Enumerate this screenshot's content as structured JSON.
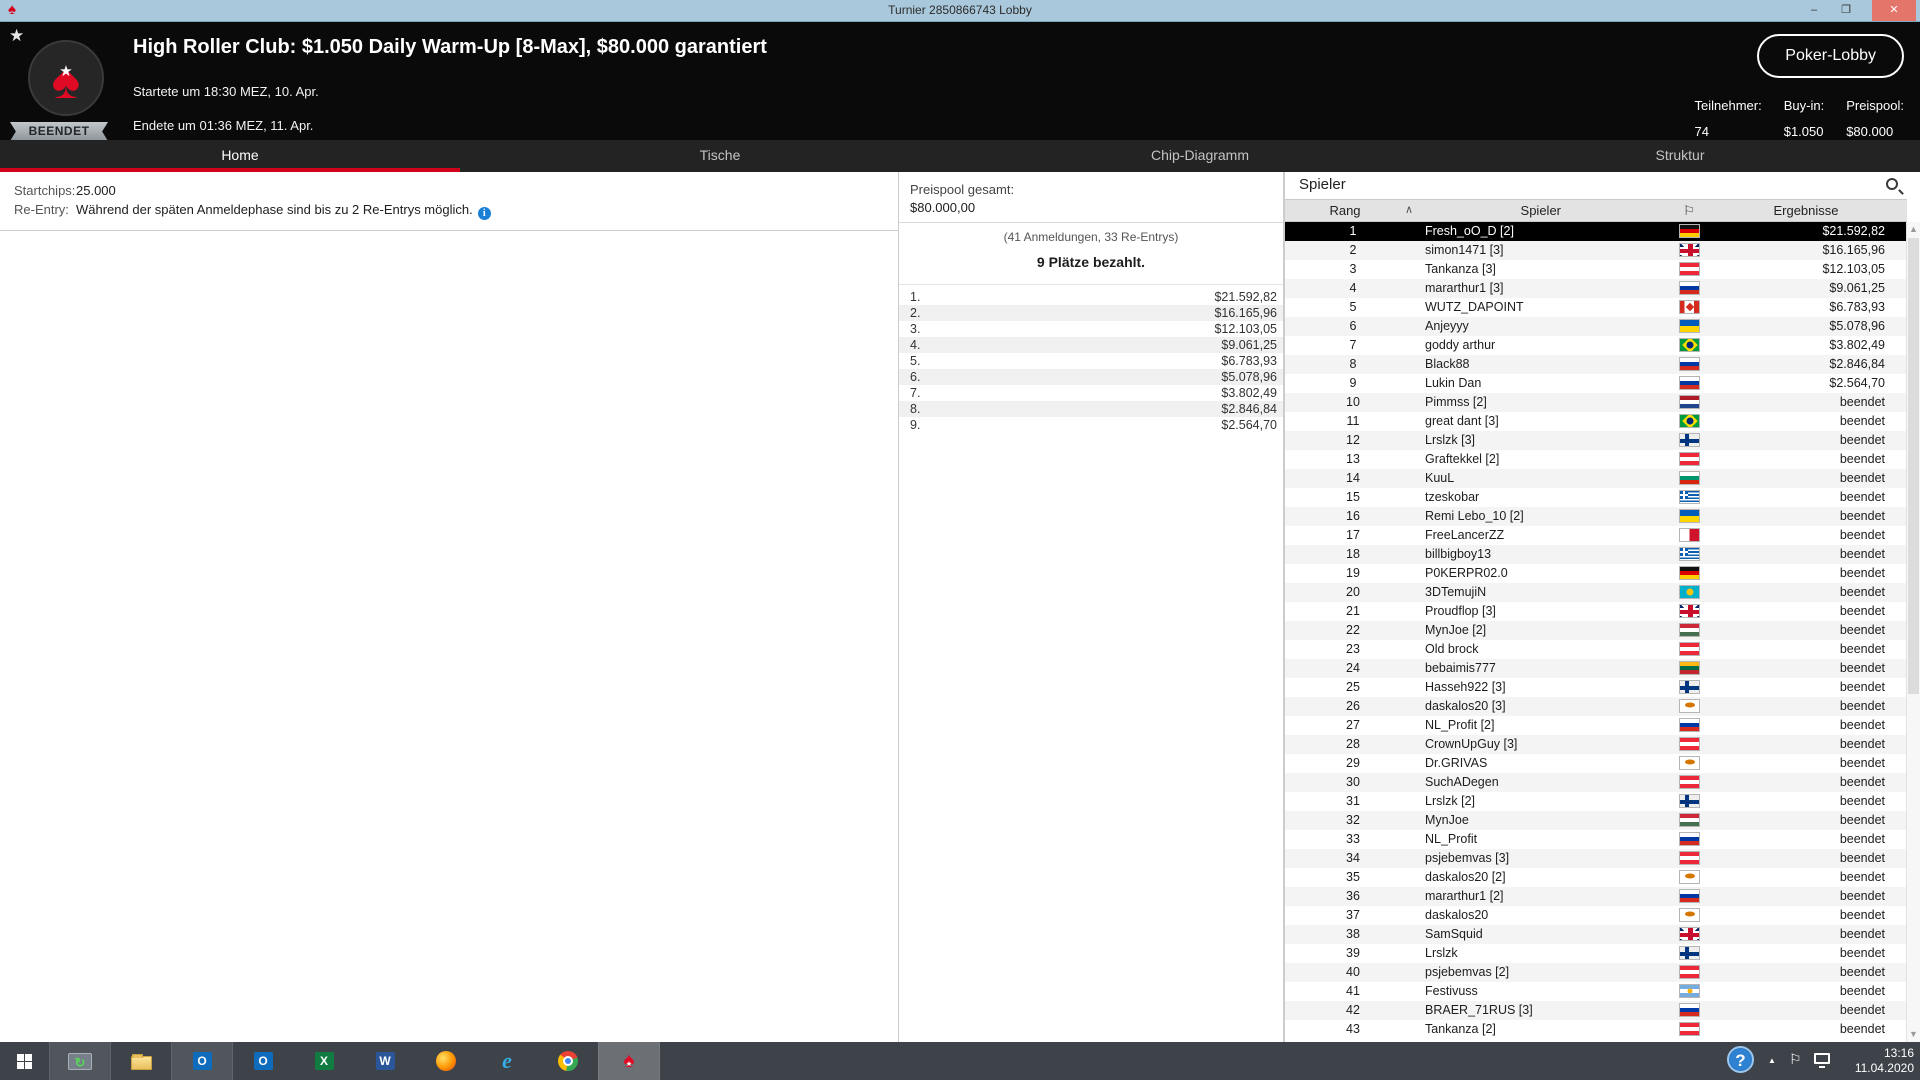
{
  "window": {
    "title": "Turnier 2850866743 Lobby",
    "controls": {
      "minimize": "–",
      "restore": "❐",
      "close": "✕"
    }
  },
  "header": {
    "status_badge": "BEENDET",
    "title": "High Roller Club: $1.050 Daily Warm-Up [8-Max], $80.000 garantiert",
    "started": "Startete um 18:30 MEZ, 10. Apr.",
    "ended": "Endete um 01:36 MEZ, 11. Apr.",
    "lobby_button": "Poker-Lobby",
    "stats": [
      {
        "label": "Teilnehmer:",
        "value": "74"
      },
      {
        "label": "Buy-in:",
        "value": "$1.050"
      },
      {
        "label": "Preispool:",
        "value": "$80.000"
      }
    ]
  },
  "tabs": [
    {
      "label": "Home",
      "active": true
    },
    {
      "label": "Tische",
      "active": false
    },
    {
      "label": "Chip-Diagramm",
      "active": false
    },
    {
      "label": "Struktur",
      "active": false
    }
  ],
  "info_panel": {
    "rows": [
      {
        "label": "Startchips:",
        "value": "25.000",
        "info_icon": false
      },
      {
        "label": "Re-Entry:",
        "value": "Während der späten Anmeldephase sind bis zu 2 Re-Entrys möglich.",
        "info_icon": true
      }
    ],
    "info_icon_glyph": "i"
  },
  "prize_panel": {
    "total_label": "Preispool gesamt:",
    "total_value": "$80.000,00",
    "registrations": "(41 Anmeldungen, 33 Re-Entrys)",
    "places_paid": "9 Plätze bezahlt.",
    "prizes": [
      {
        "place": "1.",
        "amount": "$21.592,82"
      },
      {
        "place": "2.",
        "amount": "$16.165,96"
      },
      {
        "place": "3.",
        "amount": "$12.103,05"
      },
      {
        "place": "4.",
        "amount": "$9.061,25"
      },
      {
        "place": "5.",
        "amount": "$6.783,93"
      },
      {
        "place": "6.",
        "amount": "$5.078,96"
      },
      {
        "place": "7.",
        "amount": "$3.802,49"
      },
      {
        "place": "8.",
        "amount": "$2.846,84"
      },
      {
        "place": "9.",
        "amount": "$2.564,70"
      }
    ]
  },
  "players_panel": {
    "title": "Spieler",
    "columns": {
      "rank": "Rang",
      "sort_icon": "∧",
      "player": "Spieler",
      "flag_icon": "⚐",
      "results": "Ergebnisse"
    },
    "players": [
      {
        "rank": "1",
        "name": "Fresh_oO_D [2]",
        "country": "de",
        "result": "$21.592,82",
        "selected": true
      },
      {
        "rank": "2",
        "name": "simon1471 [3]",
        "country": "gb",
        "result": "$16.165,96",
        "selected": false
      },
      {
        "rank": "3",
        "name": "Tankanza [3]",
        "country": "at",
        "result": "$12.103,05",
        "selected": false
      },
      {
        "rank": "4",
        "name": "mararthur1 [3]",
        "country": "ru",
        "result": "$9.061,25",
        "selected": false
      },
      {
        "rank": "5",
        "name": "WUTZ_DAPOINT",
        "country": "ca",
        "result": "$6.783,93",
        "selected": false
      },
      {
        "rank": "6",
        "name": "Anjeyyy",
        "country": "ua",
        "result": "$5.078,96",
        "selected": false
      },
      {
        "rank": "7",
        "name": "goddy arthur",
        "country": "br",
        "result": "$3.802,49",
        "selected": false
      },
      {
        "rank": "8",
        "name": "Black88",
        "country": "ru",
        "result": "$2.846,84",
        "selected": false
      },
      {
        "rank": "9",
        "name": "Lukin Dan",
        "country": "ru",
        "result": "$2.564,70",
        "selected": false
      },
      {
        "rank": "10",
        "name": "Pimmss [2]",
        "country": "nl",
        "result": "beendet",
        "selected": false
      },
      {
        "rank": "11",
        "name": "great dant [3]",
        "country": "br",
        "result": "beendet",
        "selected": false
      },
      {
        "rank": "12",
        "name": "Lrslzk [3]",
        "country": "fi",
        "result": "beendet",
        "selected": false
      },
      {
        "rank": "13",
        "name": "Graftekkel [2]",
        "country": "at",
        "result": "beendet",
        "selected": false
      },
      {
        "rank": "14",
        "name": "KuuL",
        "country": "bg",
        "result": "beendet",
        "selected": false
      },
      {
        "rank": "15",
        "name": "tzeskobar",
        "country": "gr",
        "result": "beendet",
        "selected": false
      },
      {
        "rank": "16",
        "name": "Remi Lebo_10 [2]",
        "country": "ua",
        "result": "beendet",
        "selected": false
      },
      {
        "rank": "17",
        "name": "FreeLancerZZ",
        "country": "mt",
        "result": "beendet",
        "selected": false
      },
      {
        "rank": "18",
        "name": "billbigboy13",
        "country": "gr",
        "result": "beendet",
        "selected": false
      },
      {
        "rank": "19",
        "name": "P0KERPR02.0",
        "country": "de",
        "result": "beendet",
        "selected": false
      },
      {
        "rank": "20",
        "name": "3DTemujiN",
        "country": "kz",
        "result": "beendet",
        "selected": false
      },
      {
        "rank": "21",
        "name": "Proudflop [3]",
        "country": "gb",
        "result": "beendet",
        "selected": false
      },
      {
        "rank": "22",
        "name": "MynJoe [2]",
        "country": "hu",
        "result": "beendet",
        "selected": false
      },
      {
        "rank": "23",
        "name": "Old brock",
        "country": "at",
        "result": "beendet",
        "selected": false
      },
      {
        "rank": "24",
        "name": "bebaimis777",
        "country": "lt",
        "result": "beendet",
        "selected": false
      },
      {
        "rank": "25",
        "name": "Hasseh922 [3]",
        "country": "fi",
        "result": "beendet",
        "selected": false
      },
      {
        "rank": "26",
        "name": "daskalos20 [3]",
        "country": "cy",
        "result": "beendet",
        "selected": false
      },
      {
        "rank": "27",
        "name": "NL_Profit [2]",
        "country": "ru",
        "result": "beendet",
        "selected": false
      },
      {
        "rank": "28",
        "name": "CrownUpGuy [3]",
        "country": "at",
        "result": "beendet",
        "selected": false
      },
      {
        "rank": "29",
        "name": "Dr.GRIVAS",
        "country": "cy",
        "result": "beendet",
        "selected": false
      },
      {
        "rank": "30",
        "name": "SuchADegen",
        "country": "at",
        "result": "beendet",
        "selected": false
      },
      {
        "rank": "31",
        "name": "Lrslzk [2]",
        "country": "fi",
        "result": "beendet",
        "selected": false
      },
      {
        "rank": "32",
        "name": "MynJoe",
        "country": "hu",
        "result": "beendet",
        "selected": false
      },
      {
        "rank": "33",
        "name": "NL_Profit",
        "country": "ru",
        "result": "beendet",
        "selected": false
      },
      {
        "rank": "34",
        "name": "psjebemvas [3]",
        "country": "at",
        "result": "beendet",
        "selected": false
      },
      {
        "rank": "35",
        "name": "daskalos20 [2]",
        "country": "cy",
        "result": "beendet",
        "selected": false
      },
      {
        "rank": "36",
        "name": "mararthur1 [2]",
        "country": "ru",
        "result": "beendet",
        "selected": false
      },
      {
        "rank": "37",
        "name": "daskalos20",
        "country": "cy",
        "result": "beendet",
        "selected": false
      },
      {
        "rank": "38",
        "name": "SamSquid",
        "country": "gb",
        "result": "beendet",
        "selected": false
      },
      {
        "rank": "39",
        "name": "Lrslzk",
        "country": "fi",
        "result": "beendet",
        "selected": false
      },
      {
        "rank": "40",
        "name": "psjebemvas [2]",
        "country": "at",
        "result": "beendet",
        "selected": false
      },
      {
        "rank": "41",
        "name": "Festivuss",
        "country": "ar",
        "result": "beendet",
        "selected": false
      },
      {
        "rank": "42",
        "name": "BRAER_71RUS [3]",
        "country": "ru",
        "result": "beendet",
        "selected": false
      },
      {
        "rank": "43",
        "name": "Tankanza [2]",
        "country": "at",
        "result": "beendet",
        "selected": false
      }
    ]
  },
  "taskbar": {
    "apps": [
      {
        "name": "start",
        "state": ""
      },
      {
        "name": "remote-desktop",
        "state": "running"
      },
      {
        "name": "file-explorer",
        "state": ""
      },
      {
        "name": "outlook",
        "state": "running"
      },
      {
        "name": "outlook-2",
        "state": ""
      },
      {
        "name": "excel",
        "state": ""
      },
      {
        "name": "word",
        "state": ""
      },
      {
        "name": "firefox",
        "state": ""
      },
      {
        "name": "internet-explorer",
        "state": ""
      },
      {
        "name": "chrome",
        "state": ""
      },
      {
        "name": "pokerstars",
        "state": "active"
      }
    ],
    "tray": {
      "time": "13:16",
      "date": "11.04.2020"
    }
  },
  "colors": {
    "accent_red": "#d0021b",
    "titlebar_blue": "#a9c8db",
    "header_black": "#0a0a0a",
    "taskbar_gray": "#3e434a",
    "selected_row": "#000000"
  }
}
